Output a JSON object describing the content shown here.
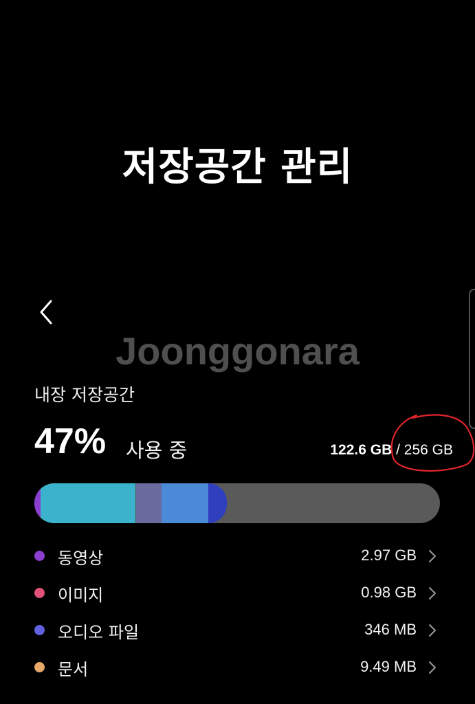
{
  "header": {
    "title": "저장공간 관리"
  },
  "watermark": "Joonggonara",
  "storage": {
    "section_title": "내장 저장공간",
    "percent": "47%",
    "in_use_label": "사용 중",
    "used": "122.6 GB",
    "separator": " / ",
    "total": "256 GB",
    "annotation_color": "#e0262c",
    "bar": {
      "track_color": "#5a5a5a",
      "segments": [
        {
          "color": "#8a3fd1",
          "fraction": 0.015
        },
        {
          "color": "#3bb3cc",
          "fraction": 0.235
        },
        {
          "color": "#6a6a9e",
          "fraction": 0.063
        },
        {
          "color": "#4a8ad6",
          "fraction": 0.115
        },
        {
          "color": "#2f3fbe",
          "fraction": 0.047
        }
      ]
    },
    "categories": [
      {
        "label": "동영상",
        "size": "2.97 GB",
        "color": "#8a3fd1"
      },
      {
        "label": "이미지",
        "size": "0.98 GB",
        "color": "#e2517a"
      },
      {
        "label": "오디오 파일",
        "size": "346 MB",
        "color": "#6060e0"
      },
      {
        "label": "문서",
        "size": "9.49 MB",
        "color": "#e7a86a"
      }
    ]
  },
  "icons": {
    "back": "chevron-left-icon",
    "row_arrow": "chevron-right-icon"
  }
}
